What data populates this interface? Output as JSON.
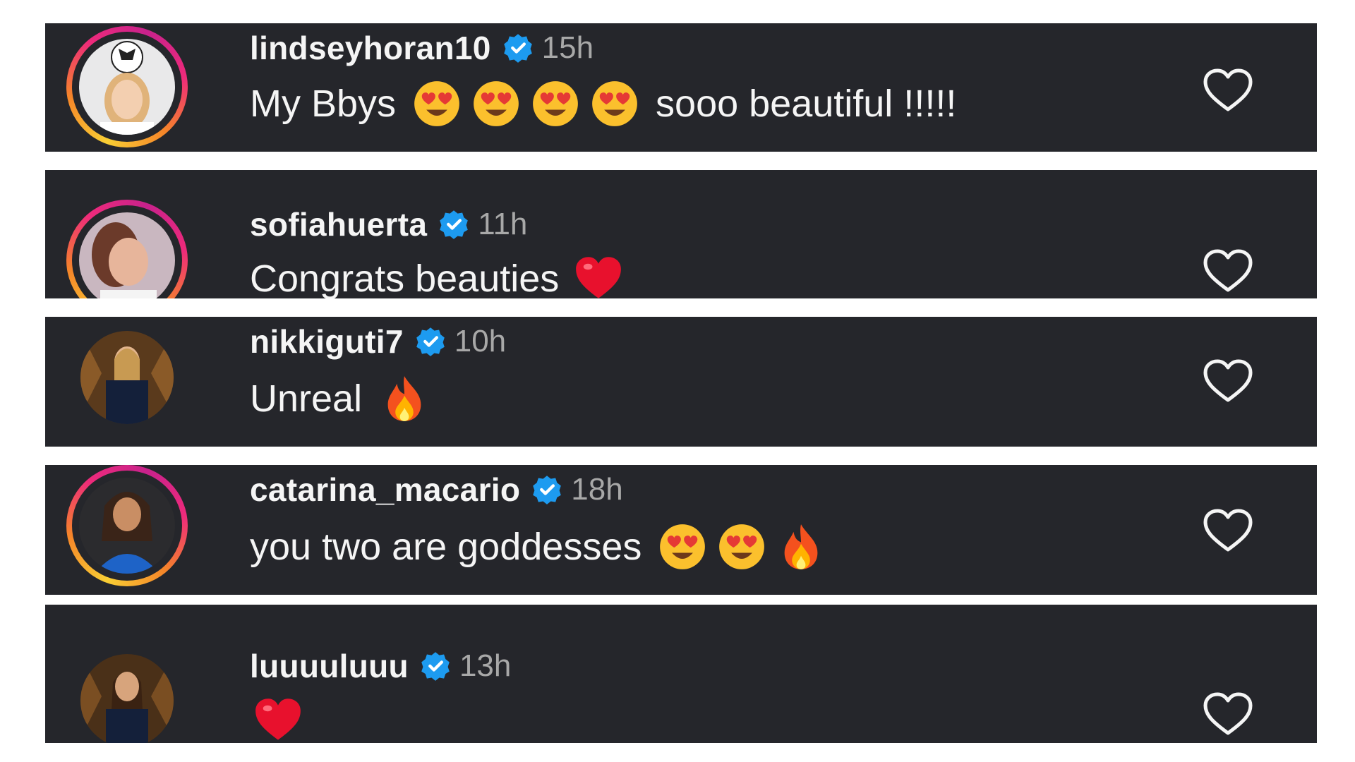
{
  "comments": [
    {
      "username": "lindseyhoran10",
      "time": "15h",
      "text_before": "My Bbys",
      "emojis": [
        "heart-eyes-emoji",
        "heart-eyes-emoji",
        "heart-eyes-emoji",
        "heart-eyes-emoji"
      ],
      "text_after": "sooo beautiful !!!!!",
      "story_ring": true,
      "avatar": "avatar-lindseyhoran10"
    },
    {
      "username": "sofiahuerta",
      "time": "11h",
      "text_before": "Congrats beauties",
      "emojis": [
        "red-heart-emoji"
      ],
      "text_after": "",
      "story_ring": true,
      "avatar": "avatar-sofiahuerta"
    },
    {
      "username": "nikkiguti7",
      "time": "10h",
      "text_before": "Unreal",
      "emojis": [
        "fire-emoji"
      ],
      "text_after": "",
      "story_ring": false,
      "avatar": "avatar-nikkiguti7"
    },
    {
      "username": "catarina_macario",
      "time": "18h",
      "text_before": "you two are goddesses",
      "emojis": [
        "heart-eyes-emoji",
        "heart-eyes-emoji",
        "fire-emoji"
      ],
      "text_after": "",
      "story_ring": true,
      "avatar": "avatar-catarina_macario"
    },
    {
      "username": "luuuuluuu",
      "time": "13h",
      "text_before": "",
      "emojis": [
        "red-heart-emoji"
      ],
      "text_after": "",
      "story_ring": false,
      "avatar": "avatar-luuuuluuu"
    }
  ],
  "colors": {
    "panel_bg": "#25262b",
    "username": "#f5f5f5",
    "time": "#a8a8a8",
    "verified": "#1d9bf0"
  }
}
